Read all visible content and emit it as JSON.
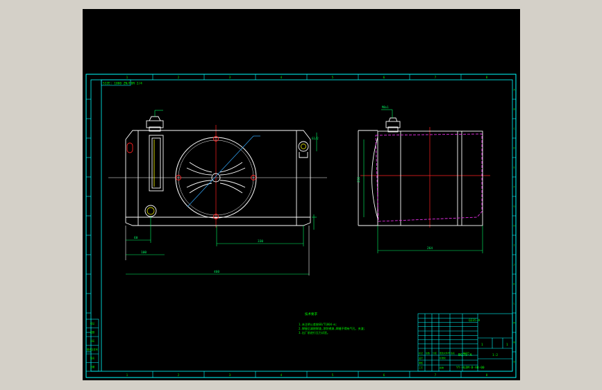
{
  "viewport": {
    "background": "#000000",
    "app_background": "#d4d0c8"
  },
  "colors": {
    "frame": "#00ffff",
    "geometry": "#ffffff",
    "centerline": "#ff2020",
    "dimension": "#00ff66",
    "hidden": "#ff33ff",
    "leader": "#33aaff",
    "text": "#00ff00",
    "highlight": "#ffff00"
  },
  "frame": {
    "column_labels": [
      "1",
      "2",
      "3",
      "4",
      "5",
      "6",
      "7",
      "8"
    ],
    "row_labels": [
      "A",
      "B",
      "C",
      "D",
      "E",
      "F",
      "G",
      "H",
      "I",
      "J",
      "K",
      "L",
      "M",
      "N",
      "O"
    ],
    "corner_note": "SIZE: 1000 ZN/FOR 2/4"
  },
  "dimensions": {
    "front_width": "460",
    "tube_span": "330",
    "left_offset": "100",
    "left_inner": "60",
    "side_depth": "264",
    "side_height": "232",
    "cap_label": "M8x1",
    "port_label": "G1/2"
  },
  "notes": {
    "heading": "技术要求",
    "lines": [
      "1.未注明公差按GB/T1804-m;",
      "2.焊接后清除焊渣,涂防锈漆,焊缝不得有气孔、夹渣;",
      "3.出厂前进行压力试验。"
    ]
  },
  "revision_strip": [
    "标记",
    "处数",
    "分区",
    "更改文件号",
    "签名",
    "日期"
  ],
  "title_block": {
    "drawing_name": "BQ75-A",
    "drawing_number": "YY-HLDM-B-AB-00",
    "scale": "1:2",
    "material": "Q235-A",
    "quantity": "1",
    "sheet": "1",
    "rows": [
      [
        "标记",
        "处数",
        "分区",
        "更改文件号",
        "签名",
        "年月日"
      ],
      [
        "设计",
        "",
        "",
        "标准化",
        "",
        ""
      ],
      [
        "审核",
        "",
        "",
        "",
        "",
        ""
      ],
      [
        "工艺",
        "",
        "",
        "批准",
        "",
        ""
      ]
    ]
  }
}
